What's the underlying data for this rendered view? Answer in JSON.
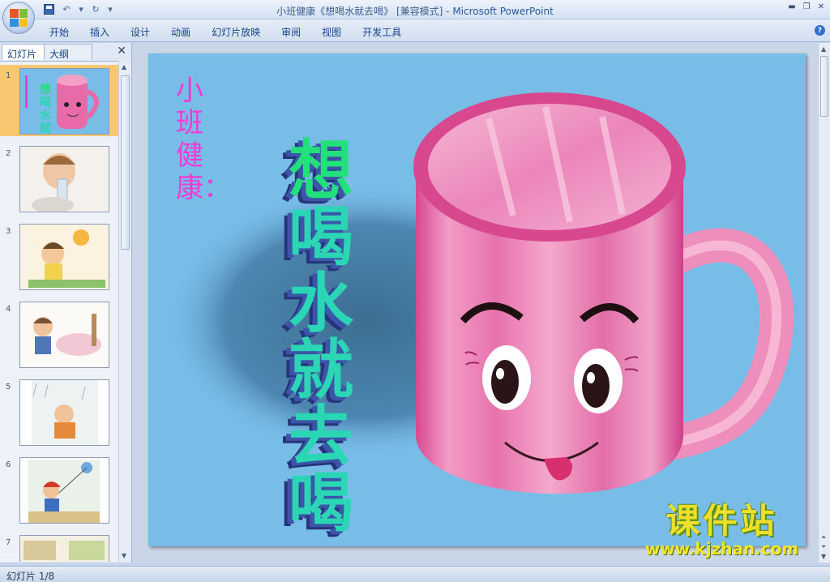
{
  "window": {
    "title_doc": "小班健康《想喝水就去喝》 [兼容模式] - ",
    "title_app": "Microsoft PowerPoint",
    "controls": [
      "minimize-icon",
      "restore-icon",
      "close-icon"
    ]
  },
  "ribbon": {
    "tabs": [
      "开始",
      "插入",
      "设计",
      "动画",
      "幻灯片放映",
      "审阅",
      "视图",
      "开发工具"
    ],
    "help_icon": "help-icon"
  },
  "panel": {
    "tab_slides": "幻灯片",
    "tab_outline": "大纲",
    "close_icon": "close-icon",
    "thumbnails": [
      {
        "num": "1",
        "selected": true
      },
      {
        "num": "2",
        "selected": false
      },
      {
        "num": "3",
        "selected": false
      },
      {
        "num": "4",
        "selected": false
      },
      {
        "num": "5",
        "selected": false
      },
      {
        "num": "6",
        "selected": false
      },
      {
        "num": "7",
        "selected": false
      }
    ]
  },
  "slide": {
    "subtitle": "小班健康：",
    "title_chars": [
      "想",
      "喝",
      "水",
      "就",
      "去",
      "喝"
    ]
  },
  "watermark": {
    "big": "课件站",
    "small": "www.kjzhan.com"
  },
  "status": {
    "slide_counter": "幻灯片 1/8"
  },
  "colors": {
    "slide_bg": "#78bce8",
    "cup_pink": "#e86aa8",
    "subtitle": "#f23ad6",
    "selected_thumb": "#f8c870"
  }
}
